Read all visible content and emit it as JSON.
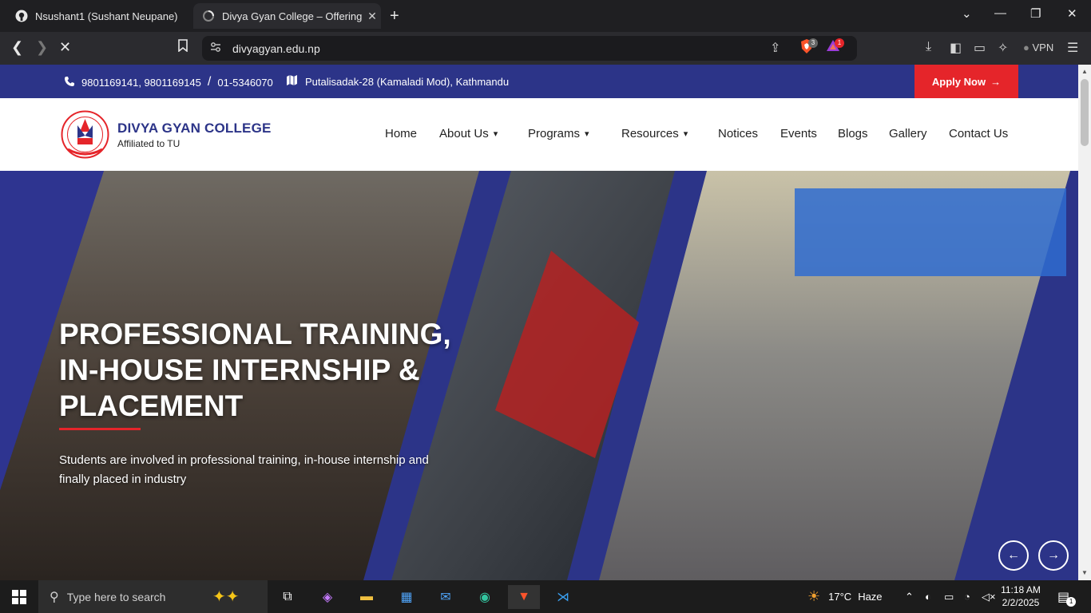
{
  "browser": {
    "tabs": [
      {
        "title": "Nsushant1 (Sushant Neupane)",
        "icon": "github-icon",
        "active": false
      },
      {
        "title": "Divya Gyan College – Offering Bachelor",
        "icon": "loading-icon",
        "active": true
      }
    ],
    "url": "divyagyan.edu.np",
    "vpn_label": "VPN",
    "brave_shield_count": "3",
    "rewards_count": "1"
  },
  "site": {
    "topbar": {
      "phones": "9801169141, 9801169145",
      "separator": "/",
      "landline": "01-5346070",
      "address": "Putalisadak-28 (Kamaladi Mod), Kathmandu",
      "apply_label": "Apply Now"
    },
    "brand": {
      "name": "DIVYA GYAN COLLEGE",
      "affiliation": "Affiliated to TU"
    },
    "nav": [
      {
        "label": "Home",
        "dropdown": false
      },
      {
        "label": "About Us",
        "dropdown": true
      },
      {
        "label": "Programs",
        "dropdown": true
      },
      {
        "label": "Resources",
        "dropdown": true
      },
      {
        "label": "Notices",
        "dropdown": false
      },
      {
        "label": "Events",
        "dropdown": false
      },
      {
        "label": "Blogs",
        "dropdown": false
      },
      {
        "label": "Gallery",
        "dropdown": false
      },
      {
        "label": "Contact Us",
        "dropdown": false
      }
    ],
    "hero": {
      "title_line1": "PROFESSIONAL TRAINING,",
      "title_line2": "IN-HOUSE INTERNSHIP &",
      "title_line3": "PLACEMENT",
      "subtitle": "Students are involved in professional training, in-house internship and finally placed in industry"
    },
    "colors": {
      "primary": "#2c3488",
      "accent": "#e5252a"
    }
  },
  "taskbar": {
    "search_placeholder": "Type here to search",
    "weather_temp": "17°C",
    "weather_desc": "Haze",
    "time": "11:18 AM",
    "date": "2/2/2025",
    "notification_count": "1"
  }
}
